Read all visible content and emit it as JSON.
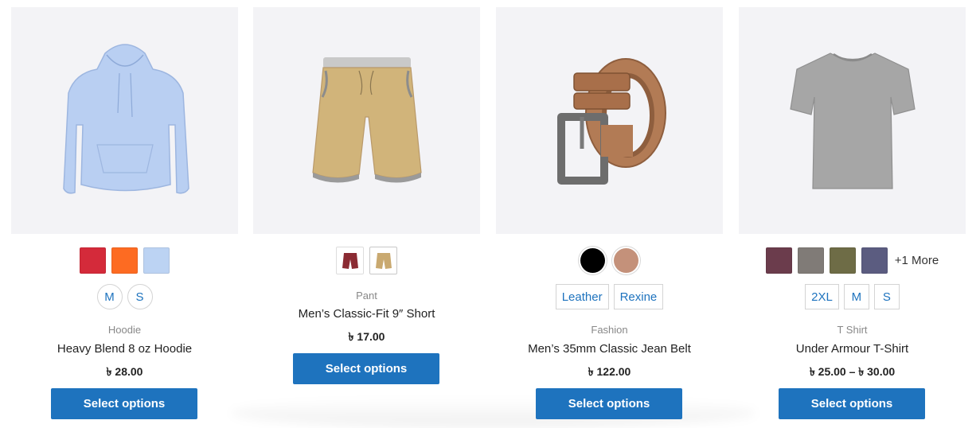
{
  "colors": {
    "button": "#1e73be",
    "link": "#1e73be",
    "image_bg": "#f3f3f6"
  },
  "products": [
    {
      "image_icon": "hoodie-image",
      "swatches": [
        {
          "name": "red",
          "color": "#d42a3a"
        },
        {
          "name": "orange",
          "color": "#fd6b22"
        },
        {
          "name": "light-blue",
          "color": "#bcd3f3"
        }
      ],
      "sizes": [
        "M",
        "S"
      ],
      "category": "Hoodie",
      "title": "Heavy Blend 8 oz Hoodie",
      "price": "৳ 28.00",
      "button": "Select options"
    },
    {
      "image_icon": "shorts-image",
      "swatches": [
        {
          "name": "maroon-shorts",
          "color": "#8b2b33"
        },
        {
          "name": "khaki-shorts",
          "color": "#c9a970"
        }
      ],
      "sizes": [],
      "category": "Pant",
      "title": "Men’s Classic-Fit 9″ Short",
      "price": "৳ 17.00",
      "button": "Select options"
    },
    {
      "image_icon": "belt-image",
      "swatches": [
        {
          "name": "black",
          "color": "#000000"
        },
        {
          "name": "tan",
          "color": "#c4917a"
        }
      ],
      "sizes": [
        "Leather",
        "Rexine"
      ],
      "category": "Fashion",
      "title": "Men’s 35mm Classic Jean Belt",
      "price": "৳ 122.00",
      "button": "Select options"
    },
    {
      "image_icon": "tshirt-image",
      "swatches": [
        {
          "name": "plum",
          "color": "#6b3c4c"
        },
        {
          "name": "gray",
          "color": "#807b77"
        },
        {
          "name": "olive",
          "color": "#6e6c46"
        },
        {
          "name": "slate-blue",
          "color": "#5b5c80"
        }
      ],
      "more": "+1 More",
      "sizes": [
        "2XL",
        "M",
        "S"
      ],
      "category": "T Shirt",
      "title": "Under Armour T-Shirt",
      "price": "৳ 25.00 – ৳ 30.00",
      "button": "Select options"
    }
  ]
}
